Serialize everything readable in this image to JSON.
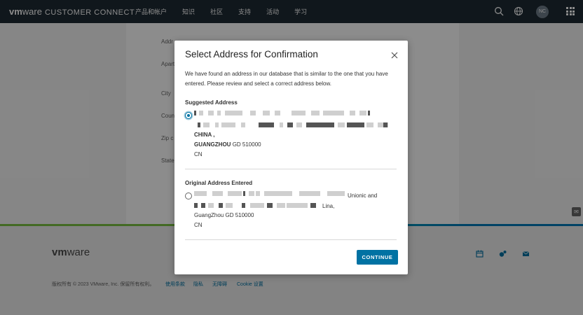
{
  "app": {
    "brand_vm": "vm",
    "brand_ware": "ware",
    "brand_suffix": "CUSTOMER CONNECT",
    "nav": [
      "产品和帐户",
      "知识",
      "社区",
      "支持",
      "活动",
      "学习"
    ],
    "avatar_initials": "NC"
  },
  "form": {
    "labels": [
      "Addr",
      "Apart",
      "City",
      "Coun",
      "Zip c",
      "State"
    ]
  },
  "footer": {
    "logo_vm": "vm",
    "logo_ware": "ware",
    "copyright": "版权所有 © 2023 VMware, Inc. 保留所有权利。",
    "links": [
      "使用条款",
      "隐私",
      "无障碍",
      "Cookie 设置"
    ]
  },
  "modal": {
    "title": "Select Address for Confirmation",
    "description": "We have found an address in our database that is similar to the one that you have entered. Please review and select a correct address below.",
    "suggested": {
      "heading": "Suggested Address",
      "selected": true,
      "line_country_name": "CHINA ,",
      "line_city": "GUANGZHOU",
      "line_region": "GD 510000",
      "line_country_code": "CN"
    },
    "original": {
      "heading": "Original Address Entered",
      "selected": false,
      "line_tail_1": "Unionic and",
      "line_tail_2": "Lina,",
      "line_city": "GuangZhou GD 510000",
      "line_country_code": "CN"
    },
    "continue_label": "CONTINUE"
  },
  "colors": {
    "accent": "#0072a3",
    "nav_bg": "#1e2a33",
    "overlay": "rgba(0,0,0,0.45)"
  },
  "icons": [
    "search-icon",
    "globe-icon",
    "apps-grid-icon",
    "close-icon",
    "calendar-icon",
    "community-icon",
    "mail-icon",
    "feedback-icon"
  ]
}
